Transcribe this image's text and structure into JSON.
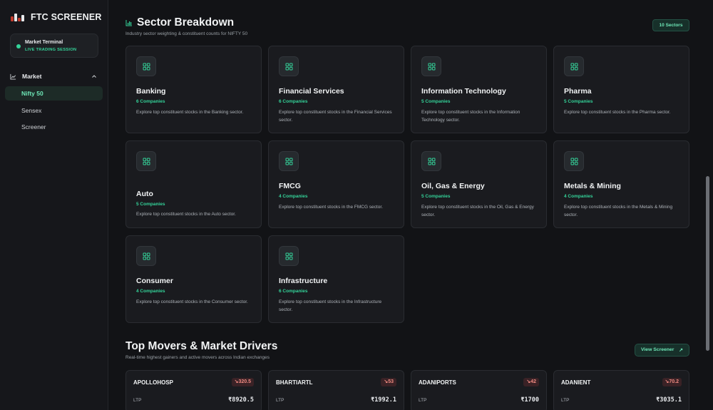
{
  "brand": {
    "title": "FTC SCREENER"
  },
  "terminal": {
    "title": "Market Terminal",
    "status": "LIVE TRADING SESSION"
  },
  "nav": {
    "group_label": "Market",
    "items": [
      {
        "label": "Nifty 50",
        "active": true
      },
      {
        "label": "Sensex",
        "active": false
      },
      {
        "label": "Screener",
        "active": false
      }
    ]
  },
  "sectors_section": {
    "title": "Sector Breakdown",
    "subtitle": "Industry sector weighting & constituent counts for NIFTY 50",
    "badge": "10 Sectors",
    "cards": [
      {
        "name": "Banking",
        "count": "6 Companies",
        "desc": "Explore top constituent stocks in the Banking sector."
      },
      {
        "name": "Financial Services",
        "count": "6 Companies",
        "desc": "Explore top constituent stocks in the Financial Services sector."
      },
      {
        "name": "Information Technology",
        "count": "5 Companies",
        "desc": "Explore top constituent stocks in the Information Technology sector."
      },
      {
        "name": "Pharma",
        "count": "5 Companies",
        "desc": "Explore top constituent stocks in the Pharma sector."
      },
      {
        "name": "Auto",
        "count": "5 Companies",
        "desc": "Explore top constituent stocks in the Auto sector."
      },
      {
        "name": "FMCG",
        "count": "4 Companies",
        "desc": "Explore top constituent stocks in the FMCG sector."
      },
      {
        "name": "Oil, Gas & Energy",
        "count": "5 Companies",
        "desc": "Explore top constituent stocks in the Oil, Gas & Energy sector."
      },
      {
        "name": "Metals & Mining",
        "count": "4 Companies",
        "desc": "Explore top constituent stocks in the Metals & Mining sector."
      },
      {
        "name": "Consumer",
        "count": "4 Companies",
        "desc": "Explore top constituent stocks in the Consumer sector."
      },
      {
        "name": "Infrastructure",
        "count": "6 Companies",
        "desc": "Explore top constituent stocks in the Infrastructure sector."
      }
    ]
  },
  "movers_section": {
    "title": "Top Movers & Market Drivers",
    "subtitle": "Real-time highest gainers and active movers across Indian exchanges",
    "button_label": "View Screener",
    "stocks": [
      {
        "symbol": "APOLLOHOSP",
        "change": "320.5",
        "ltp_label": "LTP",
        "price": "₹8920.5"
      },
      {
        "symbol": "BHARTIARTL",
        "change": "53",
        "ltp_label": "LTP",
        "price": "₹1992.1"
      },
      {
        "symbol": "ADANIPORTS",
        "change": "42",
        "ltp_label": "LTP",
        "price": "₹1700"
      },
      {
        "symbol": "ADANIENT",
        "change": "70.2",
        "ltp_label": "LTP",
        "price": "₹3035.1"
      }
    ]
  },
  "colors": {
    "accent": "#34d399",
    "negative": "#f28b82",
    "background": "#121316",
    "card": "#1a1b1f"
  }
}
